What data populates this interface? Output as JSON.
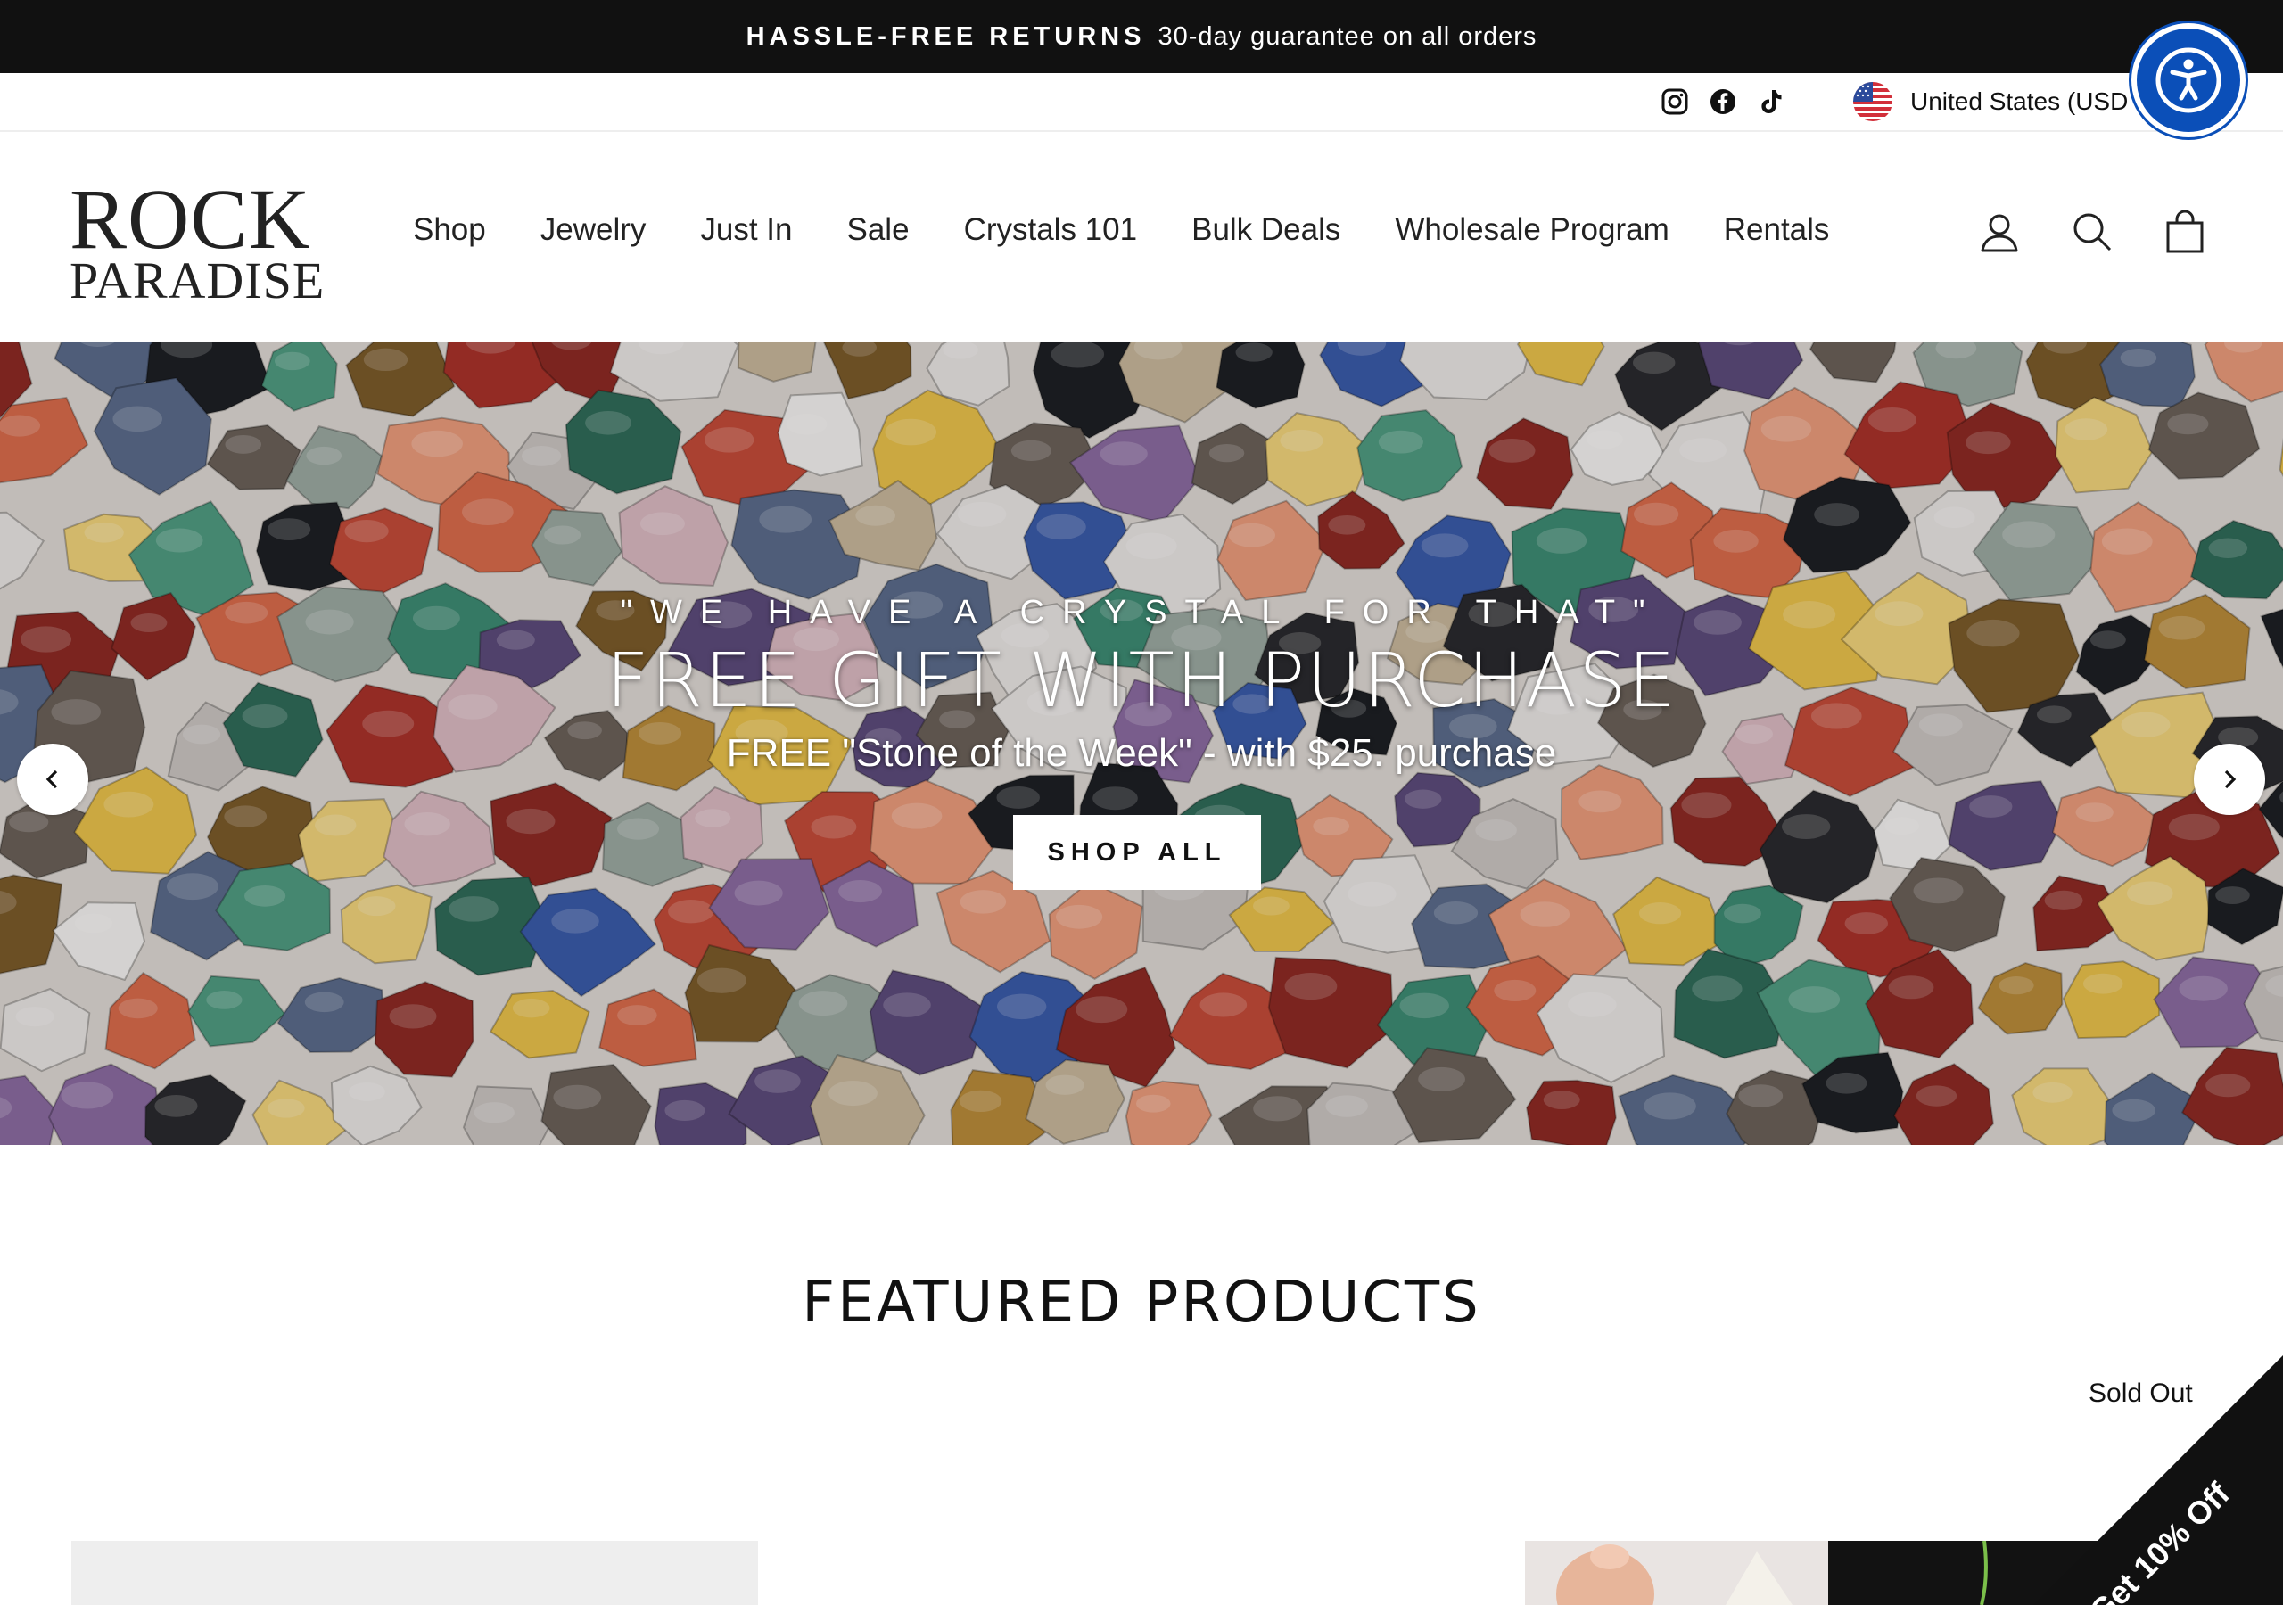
{
  "announcement": {
    "strong": "HASSLE-FREE RETURNS",
    "rest": "30-day guarantee on all orders"
  },
  "utility": {
    "social": [
      "instagram-icon",
      "facebook-icon",
      "tiktok-icon"
    ],
    "country": "United States (USD"
  },
  "accessibility": {
    "icon": "accessibility-icon"
  },
  "logo": {
    "line1": "ROCK",
    "line2": "PARADISE"
  },
  "nav": [
    "Shop",
    "Jewelry",
    "Just In",
    "Sale",
    "Crystals 101",
    "Bulk Deals",
    "Wholesale Program",
    "Rentals"
  ],
  "header_icons": [
    "account-icon",
    "search-icon",
    "cart-icon"
  ],
  "hero": {
    "kicker": "\"WE HAVE A CRYSTAL FOR THAT\"",
    "headline": "FREE GIFT WITH PURCHASE",
    "sub": "FREE \"Stone of the Week\" - with $25. purchase",
    "cta": "SHOP ALL"
  },
  "featured": {
    "title": "FEATURED PRODUCTS",
    "badge": "Sold Out"
  },
  "discount": {
    "label": "Get 10% Off"
  },
  "colors": {
    "announcement_bg": "#111111",
    "accessibility_blue": "#0b4fb8",
    "text": "#222222"
  }
}
